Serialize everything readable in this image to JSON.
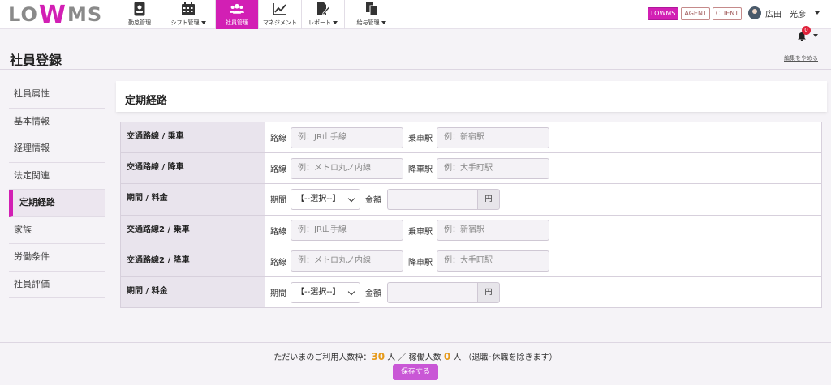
{
  "app": {
    "logo_left": "LO",
    "logo_mid": "W",
    "logo_right": "MS"
  },
  "nav": [
    {
      "label": "勤怠管理",
      "icon": "id-card-icon",
      "dropdown": false,
      "active": false
    },
    {
      "label": "シフト管理",
      "icon": "calendar-icon",
      "dropdown": true,
      "active": false
    },
    {
      "label": "社員管理",
      "icon": "users-icon",
      "dropdown": false,
      "active": true
    },
    {
      "label": "マネジメント",
      "icon": "chart-line-icon",
      "dropdown": false,
      "active": false
    },
    {
      "label": "レポート",
      "icon": "report-pen-icon",
      "dropdown": true,
      "active": false
    },
    {
      "label": "給与管理",
      "icon": "copy-icon",
      "dropdown": true,
      "active": false
    }
  ],
  "roles": [
    "LOWMS",
    "AGENT",
    "CLIENT"
  ],
  "user": {
    "name": "広田　光彦"
  },
  "notifications": {
    "count": "0"
  },
  "page": {
    "title": "社員登録",
    "stop_edit": "編集をやめる"
  },
  "sidebar": {
    "items": [
      "社員属性",
      "基本情報",
      "経理情報",
      "法定関連",
      "定期経路",
      "家族",
      "労働条件",
      "社員評価"
    ],
    "active_index": 4
  },
  "section": {
    "title": "定期経路"
  },
  "form": {
    "rows": [
      {
        "label": "交通路線 / 乗車",
        "field1_label": "路線",
        "field1_placeholder": "例：JR山手線",
        "field2_label": "乗車駅",
        "field2_placeholder": "例：新宿駅"
      },
      {
        "label": "交通路線 / 降車",
        "field1_label": "路線",
        "field1_placeholder": "例：メトロ丸ノ内線",
        "field2_label": "降車駅",
        "field2_placeholder": "例：大手町駅"
      },
      {
        "label": "期間 / 料金",
        "period_label": "期間",
        "period_value": "【--選択--】",
        "amount_label": "金額",
        "amount_unit": "円"
      },
      {
        "label": "交通路線2 / 乗車",
        "field1_label": "路線",
        "field1_placeholder": "例：JR山手線",
        "field2_label": "乗車駅",
        "field2_placeholder": "例：新宿駅"
      },
      {
        "label": "交通路線2 / 降車",
        "field1_label": "路線",
        "field1_placeholder": "例：メトロ丸ノ内線",
        "field2_label": "降車駅",
        "field2_placeholder": "例：大手町駅"
      },
      {
        "label": "期間 / 料金",
        "period_label": "期間",
        "period_value": "【--選択--】",
        "amount_label": "金額",
        "amount_unit": "円"
      }
    ]
  },
  "footer": {
    "prefix": "ただいまのご利用人数枠：",
    "quota": "30",
    "unit1": " 人 ／ 稼働人数 ",
    "active": "0",
    "unit2": " 人 （退職･休職を除きます）",
    "save_label": "保存する"
  },
  "colors": {
    "accent": "#d21fb4",
    "save_button": "#c957d6",
    "count": "#e69a1a"
  }
}
